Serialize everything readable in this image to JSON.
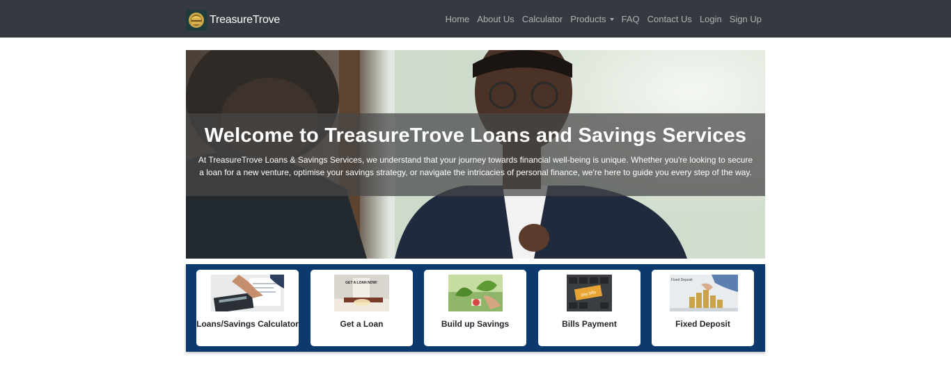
{
  "brand": {
    "name": "TreasureTrove",
    "logo_icon": "treasure-chest-icon"
  },
  "nav": {
    "items": [
      {
        "label": "Home"
      },
      {
        "label": "About Us"
      },
      {
        "label": "Calculator"
      },
      {
        "label": "Products",
        "has_dropdown": true
      },
      {
        "label": "FAQ"
      },
      {
        "label": "Contact Us"
      },
      {
        "label": "Login"
      },
      {
        "label": "Sign Up"
      }
    ]
  },
  "hero": {
    "title": "Welcome to TreasureTrove Loans and Savings Services",
    "text": "At TreasureTrove Loans & Savings Services, we understand that your journey towards financial well-being is unique. Whether you're looking to secure a loan for a new venture, optimise your savings strategy, or navigate the intricacies of personal finance, we're here to guide you every step of the way."
  },
  "services": {
    "cards": [
      {
        "label": "Loans/Savings Calculator",
        "image": "calculator-photo"
      },
      {
        "label": "Get a Loan",
        "image": "get-a-loan-photo",
        "image_text": "GET A LOAN NOW!"
      },
      {
        "label": "Build up Savings",
        "image": "savings-plant-photo"
      },
      {
        "label": "Bills Payment",
        "image": "pay-bills-keyboard-photo",
        "image_text": "pay bills"
      },
      {
        "label": "Fixed Deposit",
        "image": "fixed-deposit-coins-photo",
        "image_text": "Fixed Deposit"
      }
    ]
  },
  "colors": {
    "navbar": "#343a40",
    "services_bg": "#0c3a6e",
    "card_bg": "#ffffff",
    "overlay": "rgba(70,70,70,0.72)"
  }
}
